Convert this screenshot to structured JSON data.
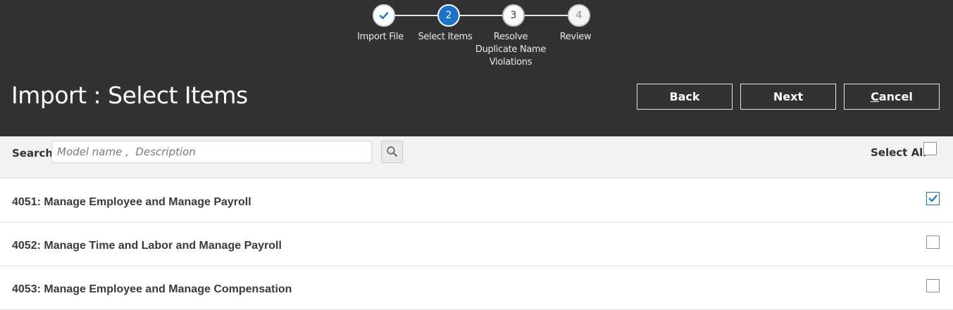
{
  "train": {
    "steps": [
      {
        "marker": "✓",
        "label": "Import File",
        "state": "done"
      },
      {
        "marker": "2",
        "label": "Select Items",
        "state": "current"
      },
      {
        "marker": "3",
        "label": "Resolve\nDuplicate Name\nViolations",
        "state": "next"
      },
      {
        "marker": "4",
        "label": "Review",
        "state": "next"
      }
    ]
  },
  "header": {
    "title": "Import : Select Items",
    "back_label": "Back",
    "next_label": "Next",
    "cancel_label": "ancel",
    "cancel_accesskey": "C"
  },
  "search": {
    "label": "Search",
    "placeholder": "Model name ,  Description",
    "value": "",
    "select_all_label": "Select All",
    "select_all_checked": false
  },
  "items": [
    {
      "label": "4051: Manage Employee and Manage Payroll",
      "checked": true
    },
    {
      "label": "4052: Manage Time and Labor and Manage Payroll",
      "checked": false
    },
    {
      "label": "4053: Manage Employee and Manage Compensation",
      "checked": false
    }
  ],
  "colors": {
    "header_bg": "#323232",
    "accent": "#1a73c9",
    "search_bar_bg": "#f2f2f2"
  }
}
